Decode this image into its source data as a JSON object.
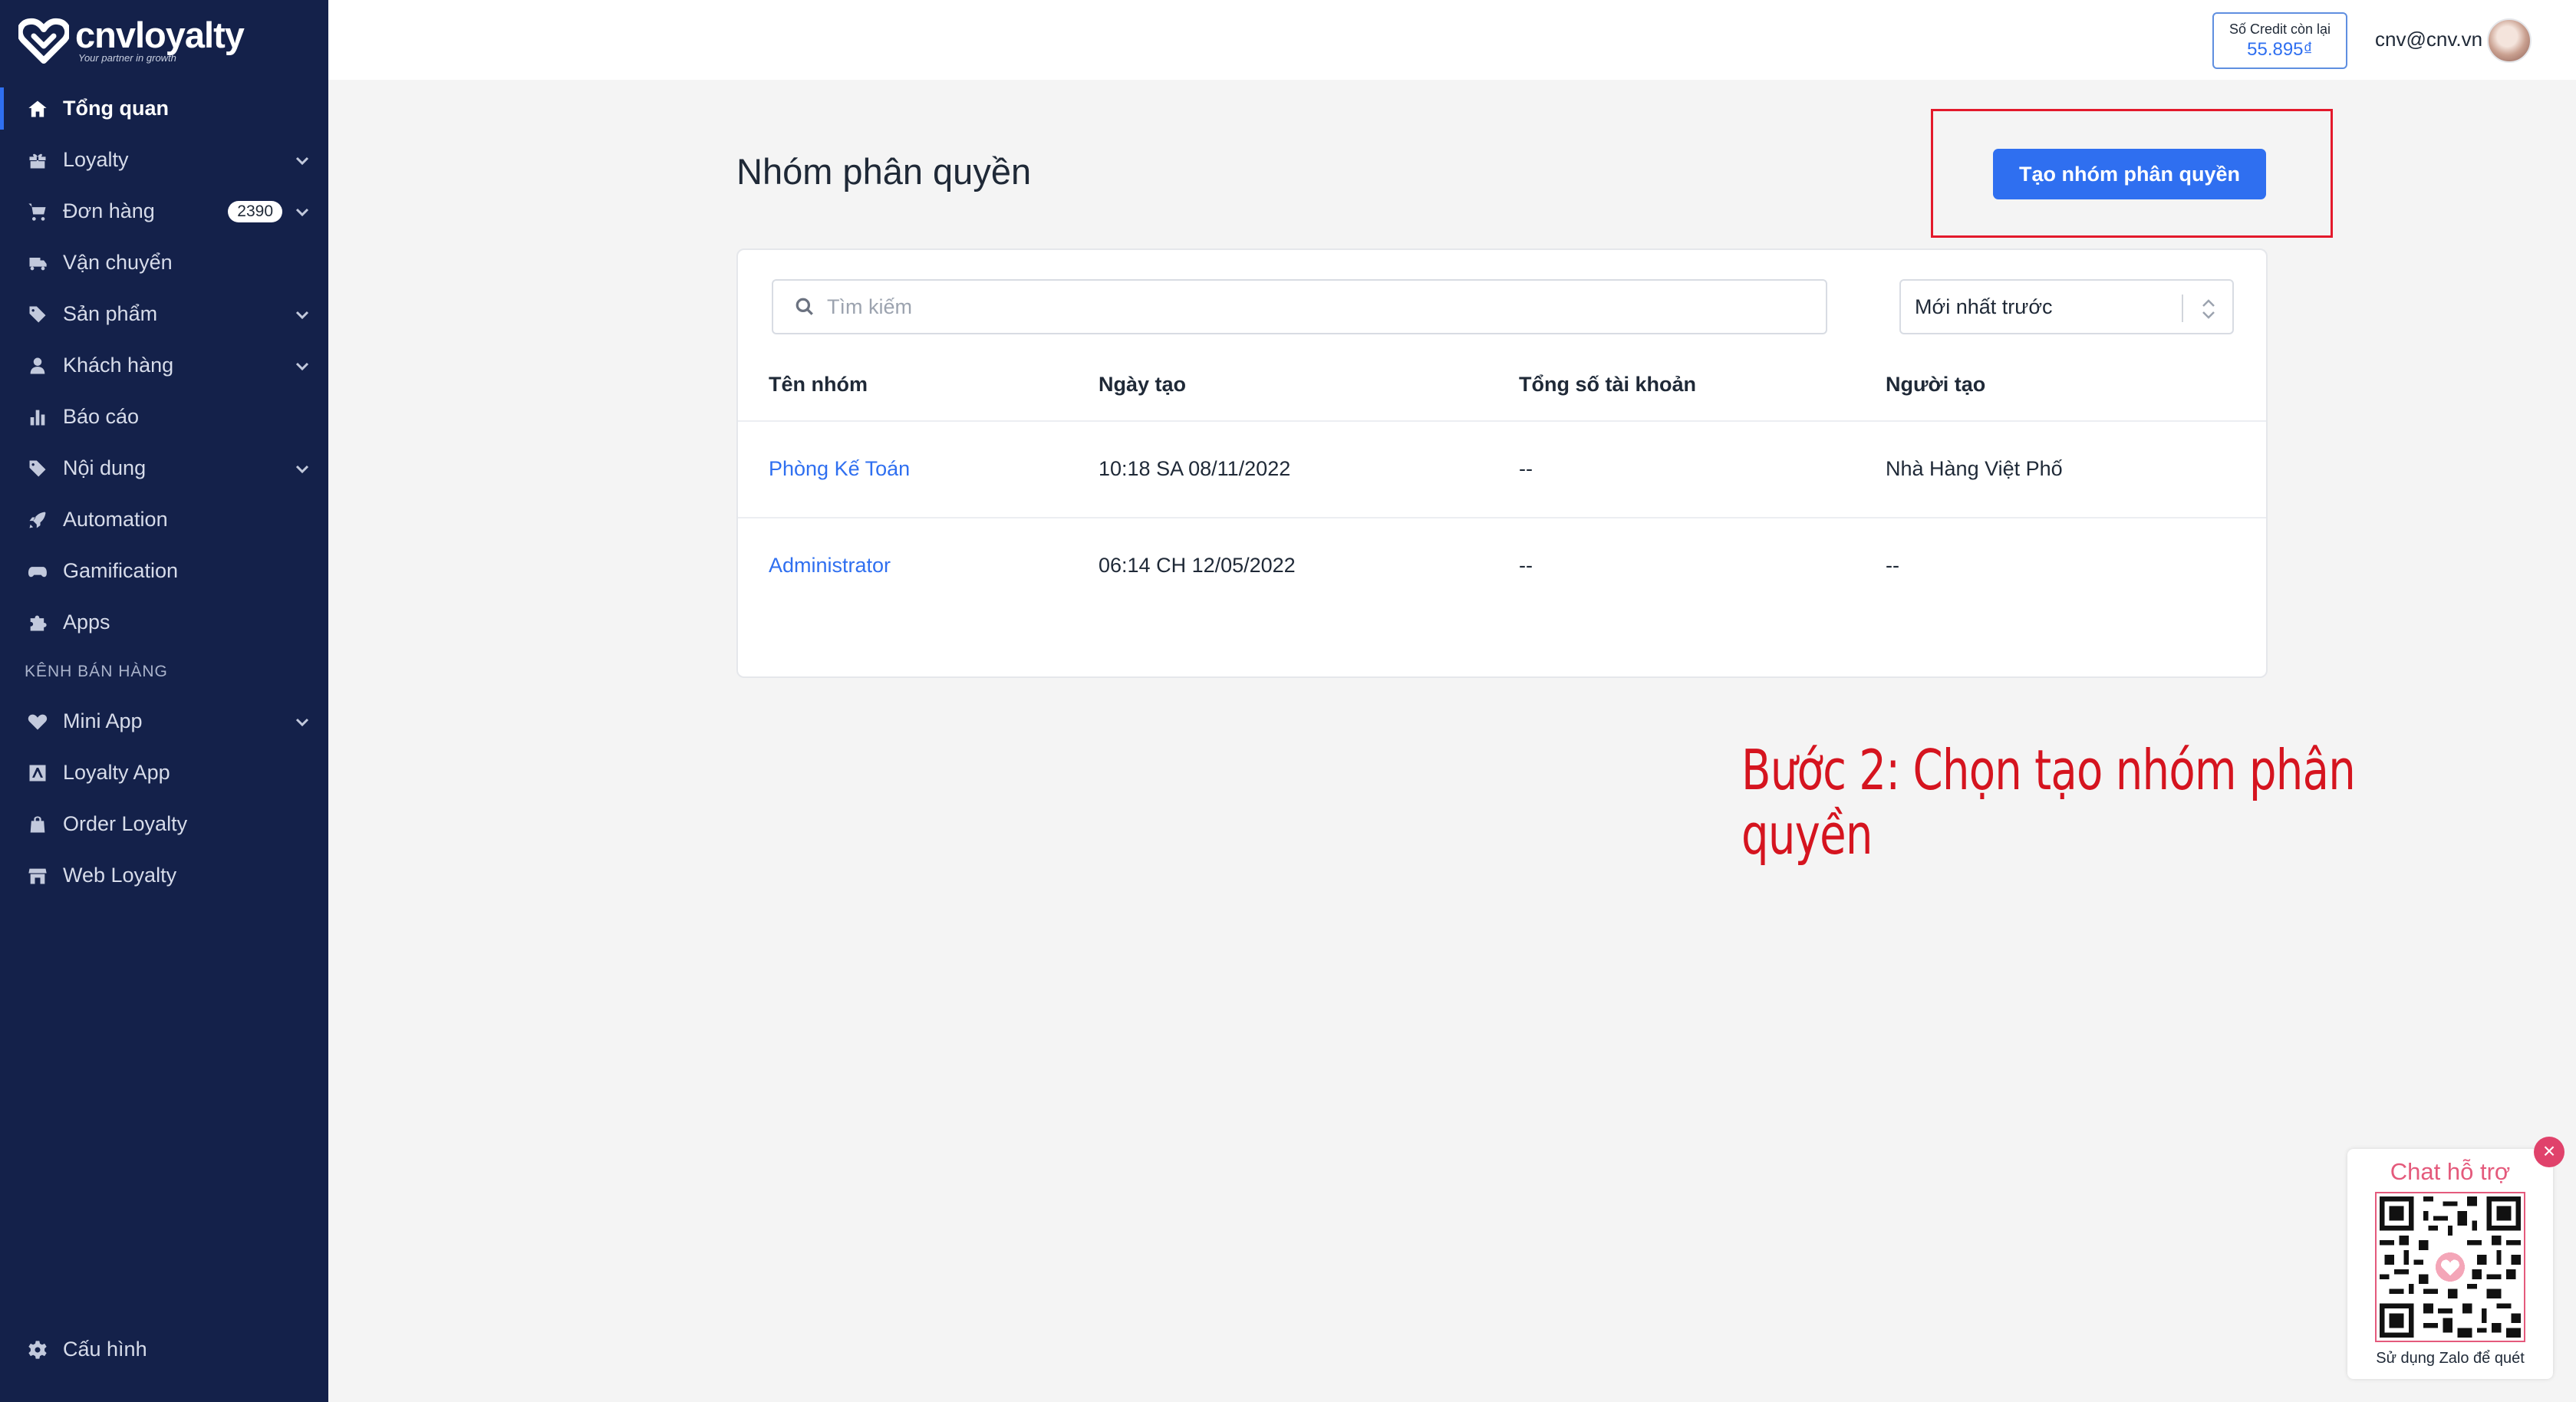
{
  "app": {
    "logo_name": "cnvloyalty",
    "logo_tagline": "Your partner in growth"
  },
  "sidebar": {
    "items": [
      {
        "label": "Tổng quan",
        "icon": "home-icon",
        "active": true
      },
      {
        "label": "Loyalty",
        "icon": "gift-icon",
        "chevron": true
      },
      {
        "label": "Đơn hàng",
        "icon": "cart-icon",
        "chevron": true,
        "badge": "2390"
      },
      {
        "label": "Vận chuyển",
        "icon": "truck-icon"
      },
      {
        "label": "Sản phẩm",
        "icon": "tag-icon",
        "chevron": true
      },
      {
        "label": "Khách hàng",
        "icon": "user-icon",
        "chevron": true
      },
      {
        "label": "Báo cáo",
        "icon": "bar-chart-icon"
      },
      {
        "label": "Nội dung",
        "icon": "tag-icon",
        "chevron": true
      },
      {
        "label": "Automation",
        "icon": "rocket-icon"
      },
      {
        "label": "Gamification",
        "icon": "gamepad-icon"
      },
      {
        "label": "Apps",
        "icon": "puzzle-icon"
      }
    ],
    "section_label": "KÊNH BÁN HÀNG",
    "channel_items": [
      {
        "label": "Mini App",
        "icon": "heart-icon",
        "chevron": true
      },
      {
        "label": "Loyalty App",
        "icon": "app-store-icon"
      },
      {
        "label": "Order Loyalty",
        "icon": "bag-icon"
      },
      {
        "label": "Web Loyalty",
        "icon": "store-icon"
      }
    ],
    "settings_label": "Cấu hình"
  },
  "topbar": {
    "credit_label": "Số Credit còn lại",
    "credit_value": "55.895₫",
    "user_email": "cnv@cnv.vn"
  },
  "page": {
    "title": "Nhóm phân quyền",
    "create_button": "Tạo nhóm phân quyền",
    "search_placeholder": "Tìm kiếm",
    "sort_value": "Mới nhất trước"
  },
  "table": {
    "columns": [
      "Tên nhóm",
      "Ngày tạo",
      "Tổng số tài khoản",
      "Người tạo"
    ],
    "rows": [
      {
        "name": "Phòng Kế Toán",
        "created": "10:18 SA  08/11/2022",
        "accounts": "--",
        "creator": "Nhà Hàng Việt Phố"
      },
      {
        "name": "Administrator",
        "created": "06:14 CH  12/05/2022",
        "accounts": "--",
        "creator": "--"
      }
    ]
  },
  "annotation": "Bước 2: Chọn tạo nhóm phân quyền",
  "chat_widget": {
    "title": "Chat hỗ trợ",
    "caption": "Sử dụng Zalo để quét"
  },
  "colors": {
    "sidebar_bg": "#14214a",
    "accent": "#2f6ff0",
    "annotation_red": "#d5141f",
    "chat_pink": "#e45a7c"
  }
}
